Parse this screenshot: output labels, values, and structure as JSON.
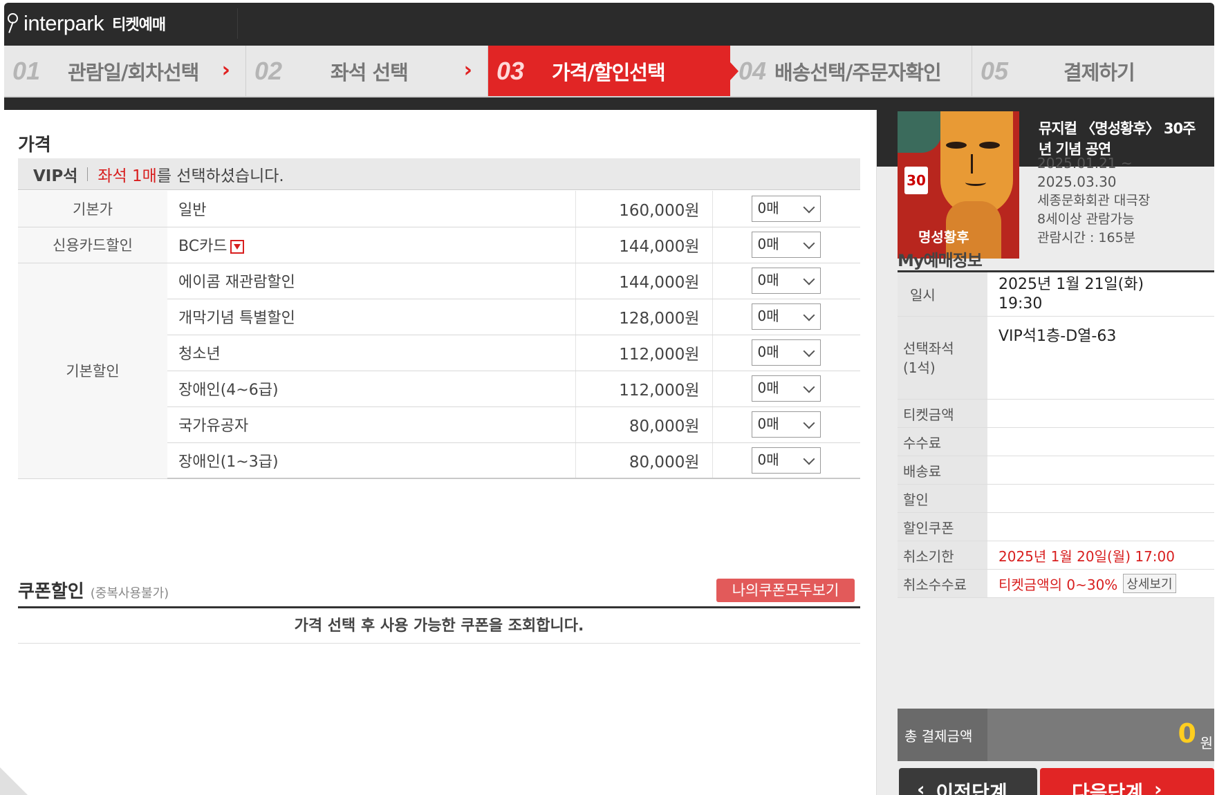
{
  "header": {
    "brand": "interpark",
    "sub": "티켓예매"
  },
  "steps": [
    {
      "num": "01",
      "label": "관람일/회차선택",
      "arrow": "›"
    },
    {
      "num": "02",
      "label": "좌석 선택",
      "arrow": "›"
    },
    {
      "num": "03",
      "label": "가격/할인선택"
    },
    {
      "num": "04",
      "label": "배송선택/주문자확인"
    },
    {
      "num": "05",
      "label": "결제하기"
    }
  ],
  "price": {
    "title": "가격",
    "grade": "VIP석",
    "selected_red": "좌석 1매",
    "selected_rest": "를 선택하셨습니다.",
    "rows": [
      {
        "category": "기본가",
        "name": "일반",
        "amount": "160,000원",
        "qty": "0매"
      },
      {
        "category": "신용카드할인",
        "name": "BC카드",
        "amount": "144,000원",
        "qty": "0매"
      },
      {
        "category": "기본할인",
        "name": "에이콤 재관람할인",
        "amount": "144,000원",
        "qty": "0매"
      },
      {
        "name": "개막기념 특별할인",
        "amount": "128,000원",
        "qty": "0매"
      },
      {
        "name": "청소년",
        "amount": "112,000원",
        "qty": "0매"
      },
      {
        "name": "장애인(4~6급)",
        "amount": "112,000원",
        "qty": "0매"
      },
      {
        "name": "국가유공자",
        "amount": "80,000원",
        "qty": "0매"
      },
      {
        "name": "장애인(1~3급)",
        "amount": "80,000원",
        "qty": "0매"
      }
    ]
  },
  "coupon": {
    "title": "쿠폰할인",
    "note": "(중복사용불가)",
    "button": "나의쿠폰모두보기",
    "message": "가격 선택 후 사용 가능한 쿠폰을 조회합니다."
  },
  "show": {
    "title": "뮤지컬 〈명성황후〉 30주년 기념 공연",
    "date_range_1": "2025.01.21 ~",
    "date_range_2": "2025.03.30",
    "venue": "세종문화회관 대극장",
    "age": "8세이상 관람가능",
    "runtime": "관람시간 : 165분",
    "poster_badge": "30",
    "poster_title": "명성황후"
  },
  "my": {
    "title": "My예매정보",
    "datetime_label": "일시",
    "datetime_value_1": "2025년 1월 21일(화)",
    "datetime_value_2": "19:30",
    "seat_label_1": "선택좌석",
    "seat_label_2": "(1석)",
    "seat_value": "VIP석1층-D열-63",
    "ticket_label": "티켓금액",
    "fee_label": "수수료",
    "delivery_label": "배송료",
    "discount_label": "할인",
    "coupon_label": "할인쿠폰",
    "cancel_deadline_label": "취소기한",
    "cancel_deadline_value": "2025년 1월 20일(월) 17:00",
    "cancel_fee_label": "취소수수료",
    "cancel_fee_value": "티켓금액의 0~30%",
    "detail_button": "상세보기",
    "total_label": "총 결제금액",
    "total_value": "0",
    "total_unit": "원"
  },
  "nav": {
    "prev": "이전단계",
    "next": "다음단계"
  },
  "colors": {
    "accent": "#e12525",
    "dark": "#2b2b2b",
    "total": "#ffce1f"
  }
}
